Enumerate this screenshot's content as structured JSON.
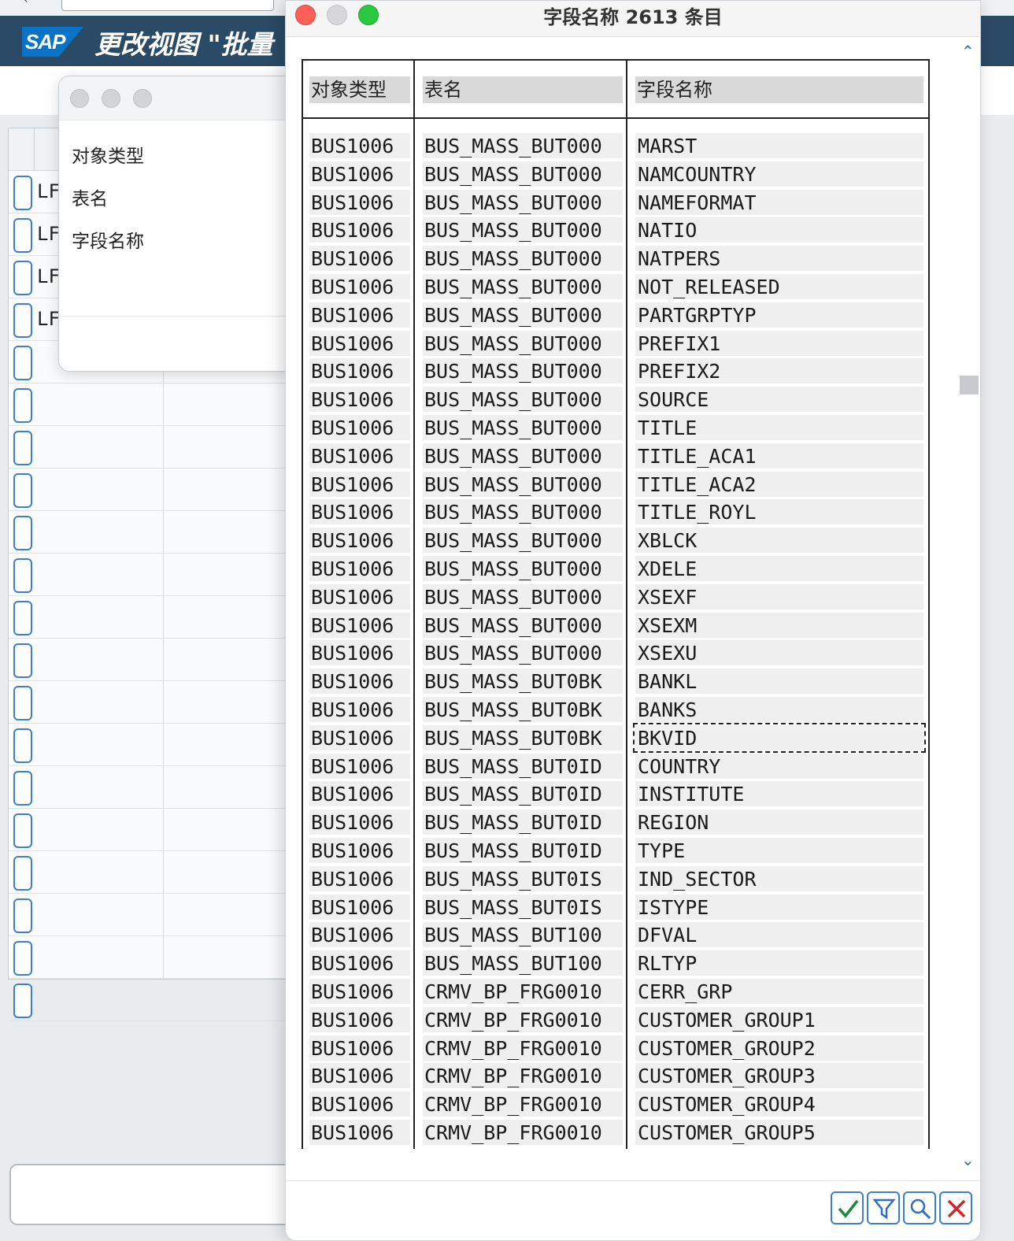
{
  "background": {
    "title": "更改视图 \"批量",
    "logo_text": "SAP",
    "rows": [
      {
        "text": "LF"
      },
      {
        "text": "LF"
      },
      {
        "text": "LF"
      },
      {
        "text": "LF"
      },
      {
        "text": ""
      },
      {
        "text": ""
      },
      {
        "text": ""
      },
      {
        "text": ""
      },
      {
        "text": ""
      },
      {
        "text": ""
      },
      {
        "text": ""
      },
      {
        "text": ""
      },
      {
        "text": ""
      },
      {
        "text": ""
      },
      {
        "text": ""
      },
      {
        "text": ""
      },
      {
        "text": ""
      },
      {
        "text": ""
      },
      {
        "text": ""
      },
      {
        "text": ""
      }
    ]
  },
  "mini_dialog": {
    "labels": [
      "对象类型",
      "表名",
      "字段名称"
    ]
  },
  "dialog": {
    "title": "字段名称 2613 条目",
    "columns": [
      "对象类型",
      "表名",
      "字段名称"
    ],
    "focused_row": 21,
    "rows": [
      [
        "BUS1006",
        "BUS_MASS_BUT000",
        "MARST"
      ],
      [
        "BUS1006",
        "BUS_MASS_BUT000",
        "NAMCOUNTRY"
      ],
      [
        "BUS1006",
        "BUS_MASS_BUT000",
        "NAMEFORMAT"
      ],
      [
        "BUS1006",
        "BUS_MASS_BUT000",
        "NATIO"
      ],
      [
        "BUS1006",
        "BUS_MASS_BUT000",
        "NATPERS"
      ],
      [
        "BUS1006",
        "BUS_MASS_BUT000",
        "NOT_RELEASED"
      ],
      [
        "BUS1006",
        "BUS_MASS_BUT000",
        "PARTGRPTYP"
      ],
      [
        "BUS1006",
        "BUS_MASS_BUT000",
        "PREFIX1"
      ],
      [
        "BUS1006",
        "BUS_MASS_BUT000",
        "PREFIX2"
      ],
      [
        "BUS1006",
        "BUS_MASS_BUT000",
        "SOURCE"
      ],
      [
        "BUS1006",
        "BUS_MASS_BUT000",
        "TITLE"
      ],
      [
        "BUS1006",
        "BUS_MASS_BUT000",
        "TITLE_ACA1"
      ],
      [
        "BUS1006",
        "BUS_MASS_BUT000",
        "TITLE_ACA2"
      ],
      [
        "BUS1006",
        "BUS_MASS_BUT000",
        "TITLE_ROYL"
      ],
      [
        "BUS1006",
        "BUS_MASS_BUT000",
        "XBLCK"
      ],
      [
        "BUS1006",
        "BUS_MASS_BUT000",
        "XDELE"
      ],
      [
        "BUS1006",
        "BUS_MASS_BUT000",
        "XSEXF"
      ],
      [
        "BUS1006",
        "BUS_MASS_BUT000",
        "XSEXM"
      ],
      [
        "BUS1006",
        "BUS_MASS_BUT000",
        "XSEXU"
      ],
      [
        "BUS1006",
        "BUS_MASS_BUT0BK",
        "BANKL"
      ],
      [
        "BUS1006",
        "BUS_MASS_BUT0BK",
        "BANKS"
      ],
      [
        "BUS1006",
        "BUS_MASS_BUT0BK",
        "BKVID"
      ],
      [
        "BUS1006",
        "BUS_MASS_BUT0ID",
        "COUNTRY"
      ],
      [
        "BUS1006",
        "BUS_MASS_BUT0ID",
        "INSTITUTE"
      ],
      [
        "BUS1006",
        "BUS_MASS_BUT0ID",
        "REGION"
      ],
      [
        "BUS1006",
        "BUS_MASS_BUT0ID",
        "TYPE"
      ],
      [
        "BUS1006",
        "BUS_MASS_BUT0IS",
        "IND_SECTOR"
      ],
      [
        "BUS1006",
        "BUS_MASS_BUT0IS",
        "ISTYPE"
      ],
      [
        "BUS1006",
        "BUS_MASS_BUT100",
        "DFVAL"
      ],
      [
        "BUS1006",
        "BUS_MASS_BUT100",
        "RLTYP"
      ],
      [
        "BUS1006",
        "CRMV_BP_FRG0010",
        "CERR_GRP"
      ],
      [
        "BUS1006",
        "CRMV_BP_FRG0010",
        "CUSTOMER_GROUP1"
      ],
      [
        "BUS1006",
        "CRMV_BP_FRG0010",
        "CUSTOMER_GROUP2"
      ],
      [
        "BUS1006",
        "CRMV_BP_FRG0010",
        "CUSTOMER_GROUP3"
      ],
      [
        "BUS1006",
        "CRMV_BP_FRG0010",
        "CUSTOMER_GROUP4"
      ],
      [
        "BUS1006",
        "CRMV_BP_FRG0010",
        "CUSTOMER_GROUP5"
      ]
    ],
    "buttons": [
      {
        "name": "confirm-button",
        "icon": "checkmark-icon",
        "color": "#1a8a3a"
      },
      {
        "name": "filter-button",
        "icon": "filter-icon",
        "color": "#2f6fbf"
      },
      {
        "name": "search-button",
        "icon": "search-icon",
        "color": "#2f6fbf"
      },
      {
        "name": "cancel-button",
        "icon": "close-icon",
        "color": "#d0262b"
      }
    ]
  }
}
